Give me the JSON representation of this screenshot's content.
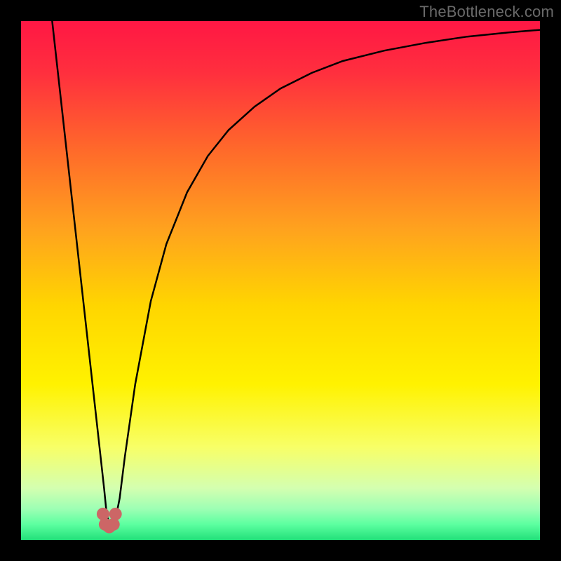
{
  "attribution": "TheBottleneck.com",
  "colors": {
    "frame": "#000000",
    "curve": "#000000",
    "dot": "#cc6666"
  },
  "chart_data": {
    "type": "line",
    "title": "",
    "xlabel": "",
    "ylabel": "",
    "xlim": [
      0,
      100
    ],
    "ylim": [
      0,
      100
    ],
    "grid": false,
    "legend": false,
    "gradient_stops": [
      {
        "pos": 0.0,
        "color": "#ff1744"
      },
      {
        "pos": 0.1,
        "color": "#ff2f3e"
      },
      {
        "pos": 0.25,
        "color": "#ff6a2a"
      },
      {
        "pos": 0.4,
        "color": "#ffa21e"
      },
      {
        "pos": 0.55,
        "color": "#ffd600"
      },
      {
        "pos": 0.7,
        "color": "#fff200"
      },
      {
        "pos": 0.82,
        "color": "#f8ff66"
      },
      {
        "pos": 0.9,
        "color": "#d4ffb0"
      },
      {
        "pos": 0.94,
        "color": "#9dffb4"
      },
      {
        "pos": 0.97,
        "color": "#5cffa0"
      },
      {
        "pos": 1.0,
        "color": "#22e07a"
      }
    ],
    "series": [
      {
        "name": "bottleneck-curve",
        "x": [
          6,
          7,
          8,
          9,
          10,
          11,
          12,
          13,
          14,
          15,
          16,
          16.5,
          17,
          18,
          19,
          20,
          22,
          25,
          28,
          32,
          36,
          40,
          45,
          50,
          56,
          62,
          70,
          78,
          86,
          94,
          100
        ],
        "y": [
          100,
          91,
          82,
          73,
          64,
          55,
          46,
          37,
          28,
          19,
          10,
          5,
          3,
          3,
          8,
          16,
          30,
          46,
          57,
          67,
          74,
          79,
          83.5,
          87,
          90,
          92.3,
          94.3,
          95.8,
          97,
          97.8,
          98.3
        ]
      }
    ],
    "dots": [
      {
        "x": 15.8,
        "y": 5
      },
      {
        "x": 16.2,
        "y": 3
      },
      {
        "x": 17.0,
        "y": 2.5
      },
      {
        "x": 17.8,
        "y": 3
      },
      {
        "x": 18.2,
        "y": 5
      }
    ]
  }
}
